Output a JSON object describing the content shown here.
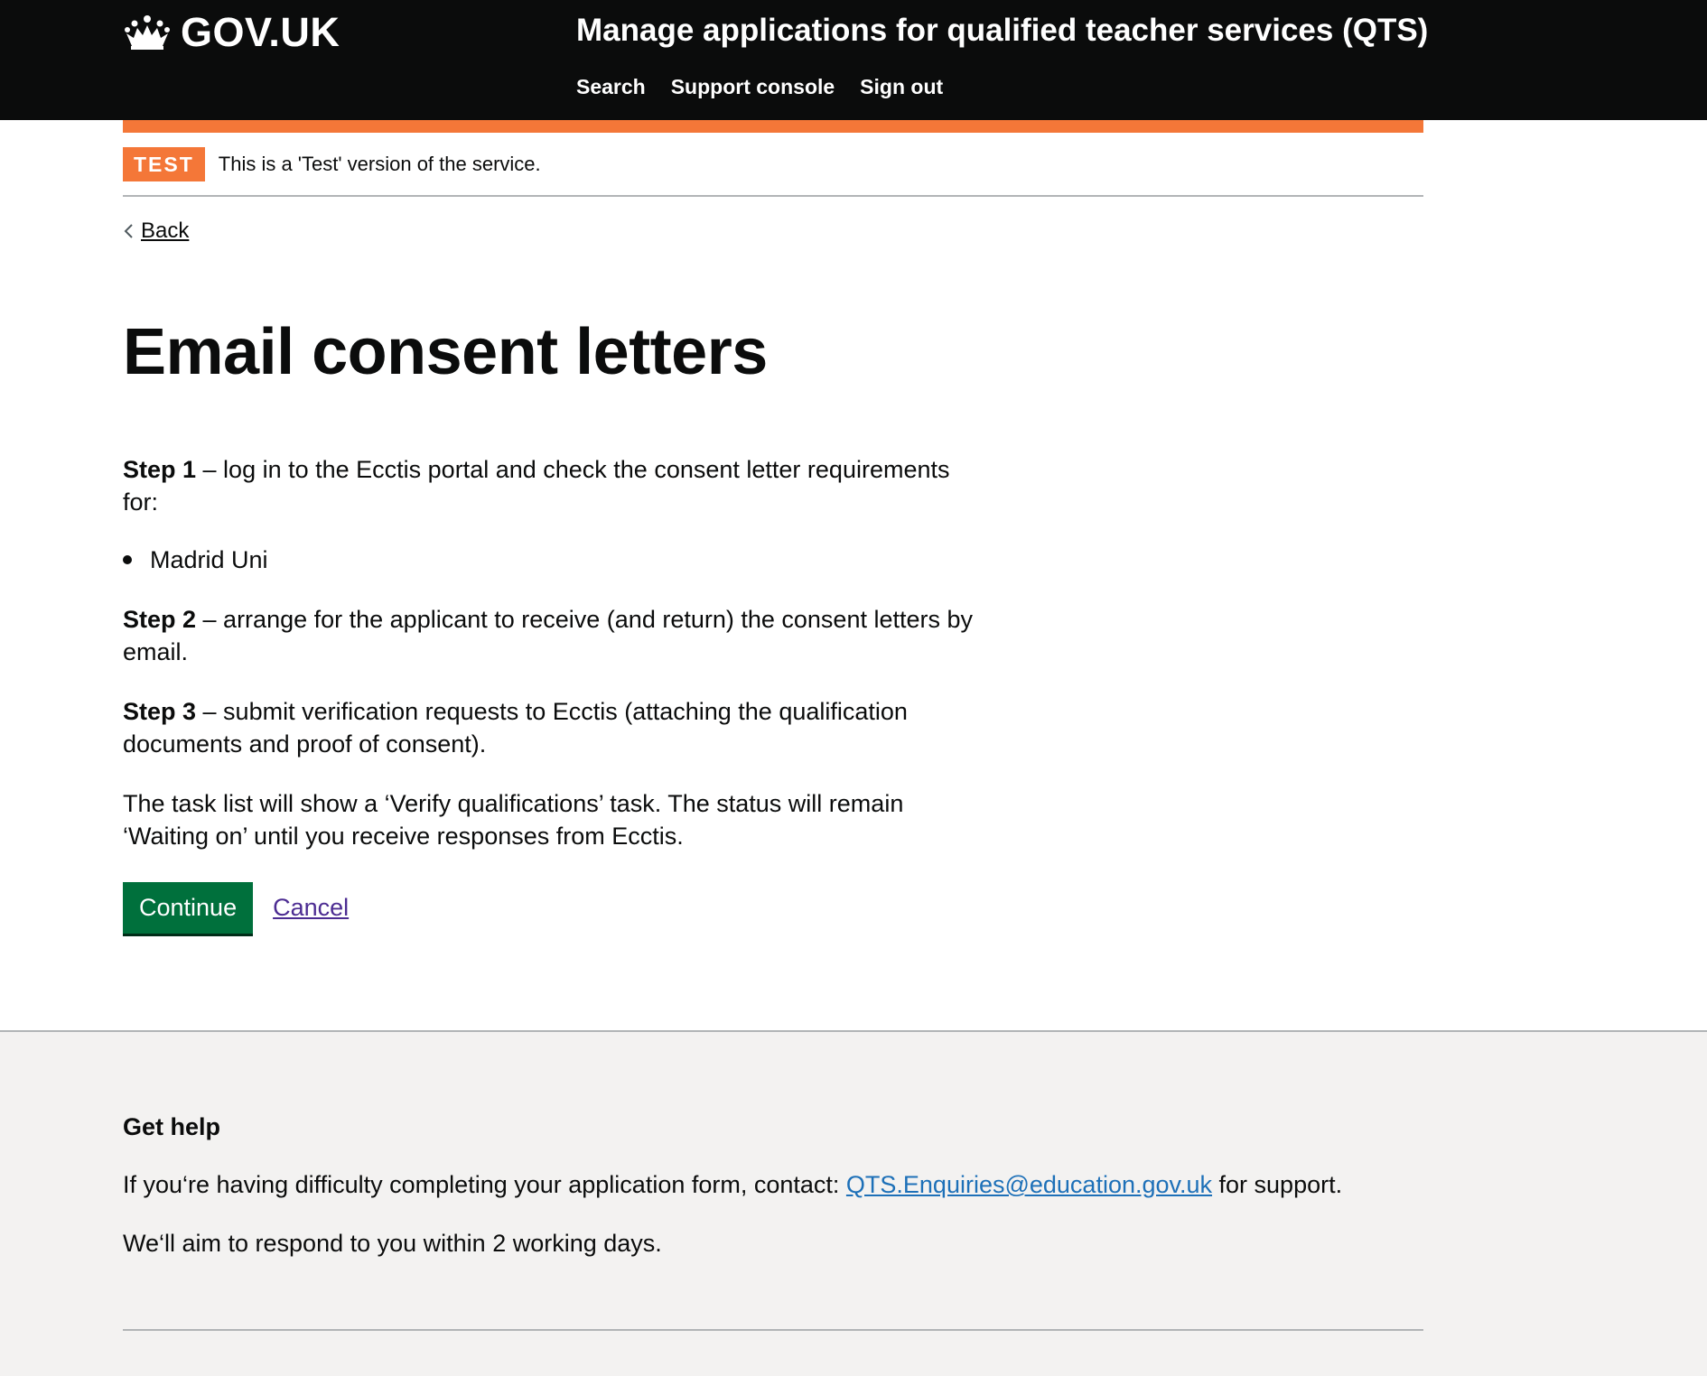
{
  "header": {
    "logo_text": "GOV.UK",
    "service_name": "Manage applications for qualified teacher services (QTS)",
    "nav": [
      "Search",
      "Support console",
      "Sign out"
    ]
  },
  "phase_banner": {
    "tag": "TEST",
    "text": "This is a 'Test' version of the service."
  },
  "back_link": "Back",
  "main": {
    "title": "Email consent letters",
    "step1_label": "Step 1",
    "step1_text": " – log in to the Ecctis portal and check the consent letter requirements for:",
    "institutions": [
      "Madrid Uni"
    ],
    "step2_label": "Step 2",
    "step2_text": " – arrange for the applicant to receive (and return) the consent letters by email.",
    "step3_label": "Step 3",
    "step3_text": " – submit verification requests to Ecctis (attaching the qualification documents and proof of consent).",
    "task_note": "The task list will show a ‘Verify qualifications’ task. The status will remain ‘Waiting on’ until you receive responses from Ecctis.",
    "continue_label": "Continue",
    "cancel_label": "Cancel"
  },
  "footer": {
    "help_title": "Get help",
    "help_prefix": "If you‘re having difficulty completing your application form, contact: ",
    "help_email": "QTS.Enquiries@education.gov.uk",
    "help_suffix": " for support.",
    "response_note": "We‘ll aim to respond to you within 2 working days."
  },
  "colors": {
    "header_bg": "#0b0c0c",
    "phase_orange": "#f47738",
    "button_green": "#00703c",
    "link_blue": "#1d70b8",
    "visited_purple": "#4c2c92",
    "footer_bg": "#f3f2f1"
  }
}
